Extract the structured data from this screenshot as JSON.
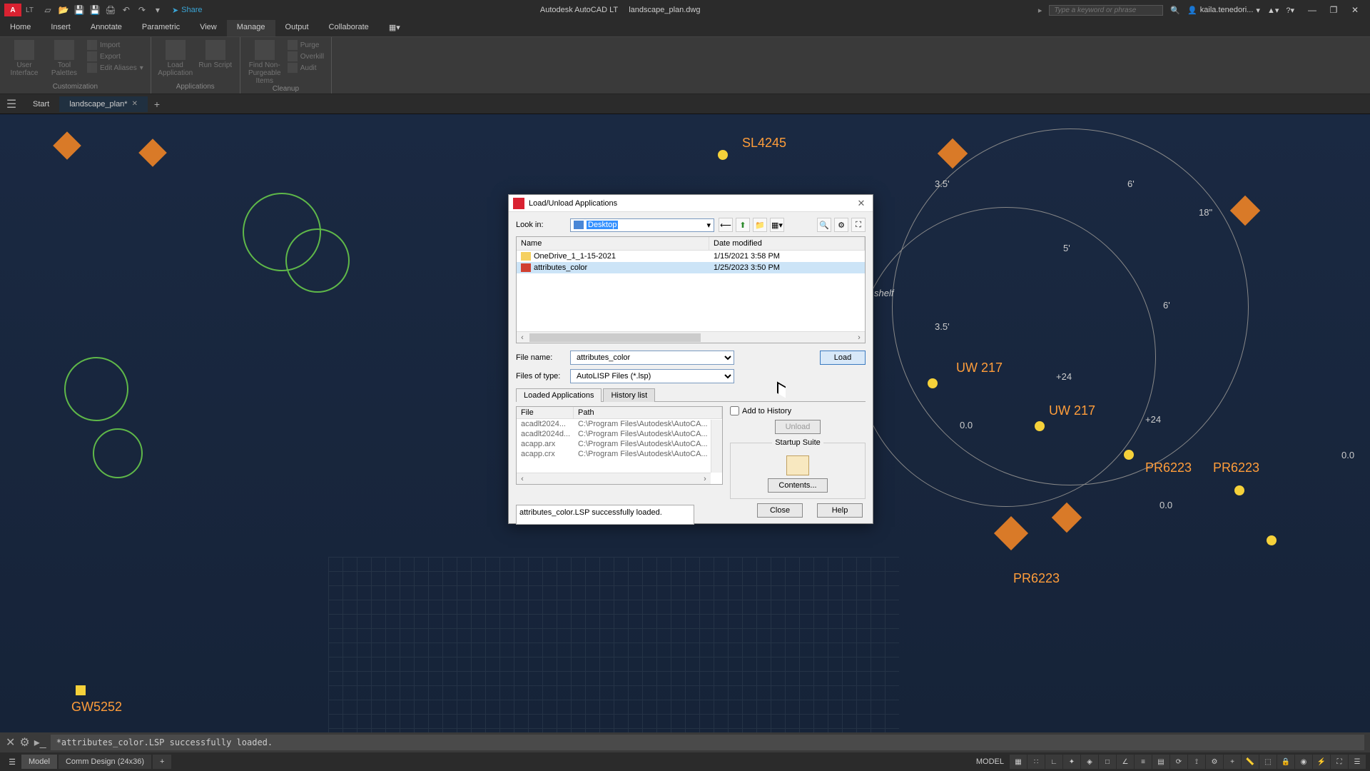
{
  "titlebar": {
    "logo": "A",
    "lt": "LT",
    "share": "Share",
    "app": "Autodesk AutoCAD LT",
    "file": "landscape_plan.dwg",
    "search_placeholder": "Type a keyword or phrase",
    "user": "kaila.tenedori...",
    "qat_icons": [
      "new-icon",
      "open-icon",
      "save-icon",
      "saveas-icon",
      "plot-icon",
      "undo-icon",
      "redo-icon"
    ]
  },
  "ribbon": {
    "tabs": [
      "Home",
      "Insert",
      "Annotate",
      "Parametric",
      "View",
      "Manage",
      "Output",
      "Collaborate"
    ],
    "active_tab": "Manage",
    "groups": {
      "customization": {
        "label": "Customization",
        "big": [
          "User Interface",
          "Tool Palettes"
        ],
        "small": [
          "Import",
          "Export",
          "Edit Aliases"
        ]
      },
      "applications": {
        "label": "Applications",
        "big": [
          "Load Application",
          "Run Script"
        ]
      },
      "cleanup": {
        "label": "Cleanup",
        "big": [
          "Find Non-Purgeable Items"
        ],
        "small": [
          "Purge",
          "Overkill",
          "Audit"
        ]
      }
    }
  },
  "filetabs": {
    "start": "Start",
    "active": "landscape_plan*"
  },
  "canvas_annotations": {
    "sl4245": "SL4245",
    "uw217a": "UW 217",
    "uw217b": "UW 217",
    "pr6223a": "PR6223",
    "pr6223b": "PR6223",
    "pr6223c": "PR6223",
    "gw5252": "GW5252",
    "plus24a": "+24",
    "plus24b": "+24",
    "dim35a": "3.5'",
    "dim35b": "3.5'",
    "dim6a": "6'",
    "dim6b": "6'",
    "dim5": "5'",
    "dim18": "18\"",
    "val00a": "0.0",
    "val00b": "0.0",
    "val00c": "0.0",
    "shelf": "shelf"
  },
  "cmdline": {
    "text": "*attributes_color.LSP successfully loaded."
  },
  "statusbar": {
    "tab_model": "Model",
    "tab_comm": "Comm Design (24x36)",
    "right_model": "MODEL"
  },
  "dialog": {
    "title": "Load/Unload Applications",
    "lookin_label": "Look in:",
    "lookin_value": "Desktop",
    "col_name": "Name",
    "col_date": "Date modified",
    "files": [
      {
        "name": "OneDrive_1_1-15-2021",
        "date": "1/15/2021 3:58 PM",
        "type": "folder"
      },
      {
        "name": "attributes_color",
        "date": "1/25/2023 3:50 PM",
        "type": "lsp",
        "selected": true
      }
    ],
    "filename_label": "File name:",
    "filename_value": "attributes_color",
    "filetype_label": "Files of type:",
    "filetype_value": "AutoLISP Files (*.lsp)",
    "load_btn": "Load",
    "tabs": {
      "loaded": "Loaded Applications",
      "history": "History list"
    },
    "add_history": "Add to History",
    "unload_btn": "Unload",
    "startup_suite": "Startup Suite",
    "contents_btn": "Contents...",
    "loaded_cols": {
      "file": "File",
      "path": "Path"
    },
    "loaded_apps": [
      {
        "file": "acadlt2024...",
        "path": "C:\\Program Files\\Autodesk\\AutoCA..."
      },
      {
        "file": "acadlt2024d...",
        "path": "C:\\Program Files\\Autodesk\\AutoCA..."
      },
      {
        "file": "acapp.arx",
        "path": "C:\\Program Files\\Autodesk\\AutoCA..."
      },
      {
        "file": "acapp.crx",
        "path": "C:\\Program Files\\Autodesk\\AutoCA..."
      }
    ],
    "status_msg": "attributes_color.LSP successfully loaded.",
    "close_btn": "Close",
    "help_btn": "Help"
  }
}
